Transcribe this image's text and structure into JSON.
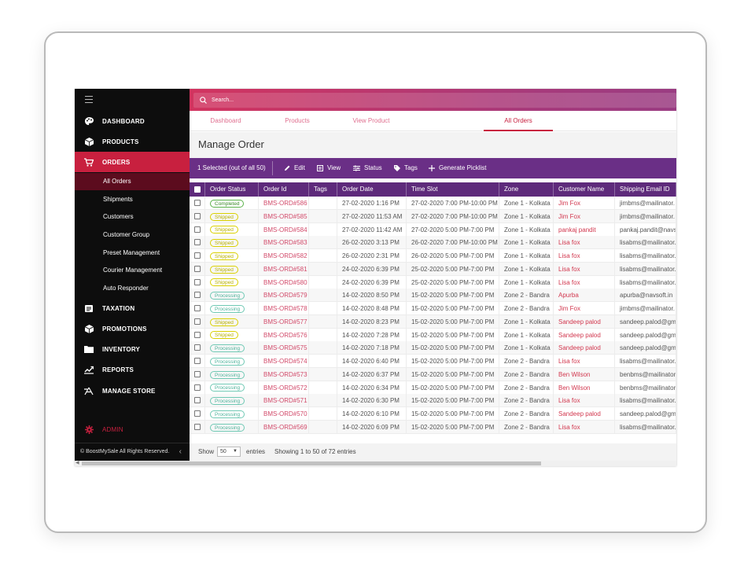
{
  "sidebar": {
    "items": [
      {
        "label": "DASHBOARD",
        "icon": "palette-icon"
      },
      {
        "label": "PRODUCTS",
        "icon": "box-icon"
      },
      {
        "label": "ORDERS",
        "icon": "cart-icon"
      },
      {
        "label": "TAXATION",
        "icon": "tax-icon"
      },
      {
        "label": "PROMOTIONS",
        "icon": "gift-icon"
      },
      {
        "label": "INVENTORY",
        "icon": "folder-icon"
      },
      {
        "label": "REPORTS",
        "icon": "chart-icon"
      },
      {
        "label": "MANAGE STORE",
        "icon": "store-icon"
      }
    ],
    "subitems": [
      "All Orders",
      "Shipments",
      "Customers",
      "Customer Group",
      "Preset Management",
      "Courier Management",
      "Auto Responder"
    ],
    "admin_label": "ADMIN",
    "copyright": "© BoostMySale All Rights Reserved."
  },
  "search": {
    "placeholder": "Search..."
  },
  "tabs": [
    "Dashboard",
    "Products",
    "View Product",
    "All Orders"
  ],
  "page_title": "Manage Order",
  "actions": {
    "selected": "1 Selected (out of all 50)",
    "edit": "Edit",
    "view": "View",
    "status": "Status",
    "tags": "Tags",
    "picklist": "Generate Picklist"
  },
  "table": {
    "columns": [
      "Order Status",
      "Order Id",
      "Tags",
      "Order Date",
      "Time Slot",
      "Zone",
      "Customer Name",
      "Shipping Email ID"
    ],
    "rows": [
      {
        "status": "Completed",
        "id": "BMS-ORD#586",
        "date": "27-02-2020 1:16 PM",
        "slot": "27-02-2020 7:00 PM-10:00 PM",
        "zone": "Zone 1 - Kolkata",
        "customer": "Jim Fox",
        "email": "jimbms@mailinator."
      },
      {
        "status": "Shipped",
        "id": "BMS-ORD#585",
        "date": "27-02-2020 11:53 AM",
        "slot": "27-02-2020 7:00 PM-10:00 PM",
        "zone": "Zone 1 - Kolkata",
        "customer": "Jim Fox",
        "email": "jimbms@mailinator."
      },
      {
        "status": "Shipped",
        "id": "BMS-ORD#584",
        "date": "27-02-2020 11:42 AM",
        "slot": "27-02-2020 5:00 PM-7:00 PM",
        "zone": "Zone 1 - Kolkata",
        "customer": "pankaj pandit",
        "email": "pankaj.pandit@navs"
      },
      {
        "status": "Shipped",
        "id": "BMS-ORD#583",
        "date": "26-02-2020 3:13 PM",
        "slot": "26-02-2020 7:00 PM-10:00 PM",
        "zone": "Zone 1 - Kolkata",
        "customer": "Lisa fox",
        "email": "lisabms@mailinator."
      },
      {
        "status": "Shipped",
        "id": "BMS-ORD#582",
        "date": "26-02-2020 2:31 PM",
        "slot": "26-02-2020 5:00 PM-7:00 PM",
        "zone": "Zone 1 - Kolkata",
        "customer": "Lisa fox",
        "email": "lisabms@mailinator."
      },
      {
        "status": "Shipped",
        "id": "BMS-ORD#581",
        "date": "24-02-2020 6:39 PM",
        "slot": "25-02-2020 5:00 PM-7:00 PM",
        "zone": "Zone 1 - Kolkata",
        "customer": "Lisa fox",
        "email": "lisabms@mailinator."
      },
      {
        "status": "Shipped",
        "id": "BMS-ORD#580",
        "date": "24-02-2020 6:39 PM",
        "slot": "25-02-2020 5:00 PM-7:00 PM",
        "zone": "Zone 1 - Kolkata",
        "customer": "Lisa fox",
        "email": "lisabms@mailinator."
      },
      {
        "status": "Processing",
        "id": "BMS-ORD#579",
        "date": "14-02-2020 8:50 PM",
        "slot": "15-02-2020 5:00 PM-7:00 PM",
        "zone": "Zone 2 - Bandra",
        "customer": "Apurba",
        "email": "apurba@navsoft.in"
      },
      {
        "status": "Processing",
        "id": "BMS-ORD#578",
        "date": "14-02-2020 8:48 PM",
        "slot": "15-02-2020 5:00 PM-7:00 PM",
        "zone": "Zone 2 - Bandra",
        "customer": "Jim Fox",
        "email": "jimbms@mailinator."
      },
      {
        "status": "Shipped",
        "id": "BMS-ORD#577",
        "date": "14-02-2020 8:23 PM",
        "slot": "15-02-2020 5:00 PM-7:00 PM",
        "zone": "Zone 1 - Kolkata",
        "customer": "Sandeep palod",
        "email": "sandeep.palod@gma"
      },
      {
        "status": "Shipped",
        "id": "BMS-ORD#576",
        "date": "14-02-2020 7:28 PM",
        "slot": "15-02-2020 5:00 PM-7:00 PM",
        "zone": "Zone 1 - Kolkata",
        "customer": "Sandeep palod",
        "email": "sandeep.palod@gma"
      },
      {
        "status": "Processing",
        "id": "BMS-ORD#575",
        "date": "14-02-2020 7:18 PM",
        "slot": "15-02-2020 5:00 PM-7:00 PM",
        "zone": "Zone 1 - Kolkata",
        "customer": "Sandeep palod",
        "email": "sandeep.palod@gma"
      },
      {
        "status": "Processing",
        "id": "BMS-ORD#574",
        "date": "14-02-2020 6:40 PM",
        "slot": "15-02-2020 5:00 PM-7:00 PM",
        "zone": "Zone 2 - Bandra",
        "customer": "Lisa fox",
        "email": "lisabms@mailinator."
      },
      {
        "status": "Processing",
        "id": "BMS-ORD#573",
        "date": "14-02-2020 6:37 PM",
        "slot": "15-02-2020 5:00 PM-7:00 PM",
        "zone": "Zone 2 - Bandra",
        "customer": "Ben Wilson",
        "email": "benbms@mailinator"
      },
      {
        "status": "Processing",
        "id": "BMS-ORD#572",
        "date": "14-02-2020 6:34 PM",
        "slot": "15-02-2020 5:00 PM-7:00 PM",
        "zone": "Zone 2 - Bandra",
        "customer": "Ben Wilson",
        "email": "benbms@mailinator"
      },
      {
        "status": "Processing",
        "id": "BMS-ORD#571",
        "date": "14-02-2020 6:30 PM",
        "slot": "15-02-2020 5:00 PM-7:00 PM",
        "zone": "Zone 2 - Bandra",
        "customer": "Lisa fox",
        "email": "lisabms@mailinator."
      },
      {
        "status": "Processing",
        "id": "BMS-ORD#570",
        "date": "14-02-2020 6:10 PM",
        "slot": "15-02-2020 5:00 PM-7:00 PM",
        "zone": "Zone 2 - Bandra",
        "customer": "Sandeep palod",
        "email": "sandeep.palod@gma"
      },
      {
        "status": "Processing",
        "id": "BMS-ORD#569",
        "date": "14-02-2020 6:09 PM",
        "slot": "15-02-2020 5:00 PM-7:00 PM",
        "zone": "Zone 2 - Bandra",
        "customer": "Lisa fox",
        "email": "lisabms@mailinator."
      }
    ]
  },
  "footer": {
    "show": "Show",
    "page_size": "50",
    "entries": "entries",
    "info": "Showing 1 to 50 of 72 entries"
  },
  "colors": {
    "accent": "#c8203f",
    "purple": "#6a2f86",
    "sidebar": "#0d0d0d"
  }
}
